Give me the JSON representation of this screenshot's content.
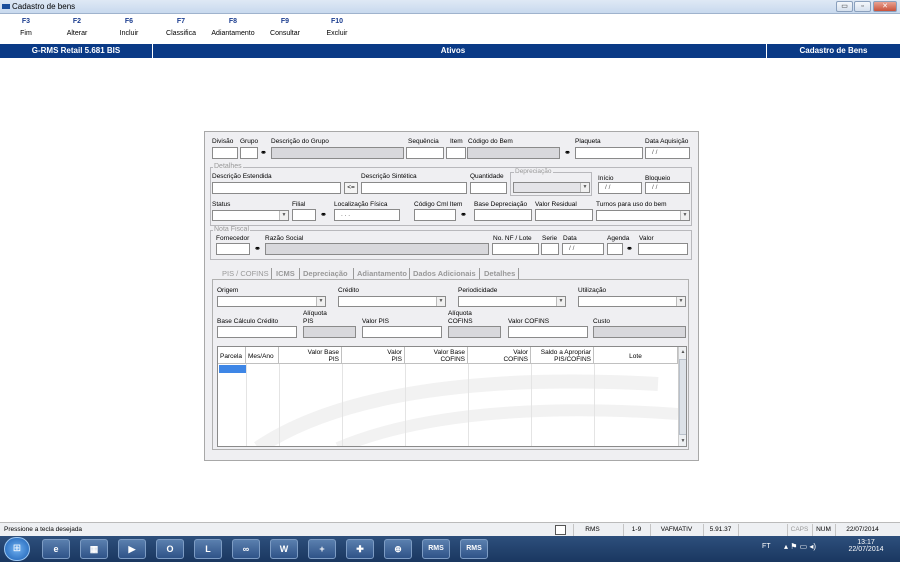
{
  "window": {
    "title": "Cadastro de bens",
    "minimize": "▭",
    "maximize": "▫",
    "close": "✕"
  },
  "toolbar": [
    {
      "key": "F3",
      "label": "Fim"
    },
    {
      "key": "F2",
      "label": "Alterar"
    },
    {
      "key": "F6",
      "label": "Incluir"
    },
    {
      "key": "F7",
      "label": "Classifica"
    },
    {
      "key": "F8",
      "label": "Adiantamento"
    },
    {
      "key": "F9",
      "label": "Consultar"
    },
    {
      "key": "F10",
      "label": "Excluir"
    }
  ],
  "header": {
    "app": "G-RMS Retail 5.681 BIS",
    "status": "Ativos",
    "screen": "Cadastro de Bens"
  },
  "form": {
    "divisao": "Divisão",
    "grupo": "Grupo",
    "desc_grupo": "Descrição do Grupo",
    "sequencia": "Sequência",
    "item": "Item",
    "codigo_bem": "Código do Bem",
    "plaqueta": "Plaqueta",
    "data_aquisicao": "Data Aquisição",
    "data_aquisicao_value": "/ /",
    "detalhes": "Detalhes",
    "desc_estendida": "Descrição Estendida",
    "copy_btn": "<=",
    "desc_sintetica": "Descrição Sintética",
    "quantidade": "Quantidade",
    "depreciacao": "Depreciação",
    "inicio": "Início",
    "inicio_value": "/ /",
    "bloqueio": "Bloqueio",
    "bloqueio_value": "/ /",
    "status": "Status",
    "filial": "Filial",
    "localizacao": "Localização Física",
    "localizacao_value": ". . .",
    "codigo_cml": "Código Cml Item",
    "base_depreciacao": "Base Depreciação",
    "valor_residual": "Valor Residual",
    "turnos": "Turnos para uso do bem",
    "nota_fiscal": "Nota Fiscal",
    "fornecedor": "Fornecedor",
    "razao_social": "Razão Social",
    "nf_lote": "No. NF / Lote",
    "serie": "Serie",
    "data": "Data",
    "data_value": "/ /",
    "agenda": "Agenda",
    "valor": "Valor"
  },
  "tabs": [
    "PIS / COFINS",
    "ICMS",
    "Depreciação",
    "Adiantamento",
    "Dados Adicionais",
    "Detalhes"
  ],
  "pis": {
    "origem": "Origem",
    "credito": "Crédito",
    "periodicidade": "Periodicidade",
    "utilizacao": "Utilização",
    "base_calc": "Base Cálculo Crédito",
    "aliq_pis_1": "Alíquota",
    "aliq_pis_2": "PIS",
    "valor_pis": "Valor PIS",
    "aliq_cofins_1": "Alíquota",
    "aliq_cofins_2": "COFINS",
    "valor_cofins": "Valor COFINS",
    "custo": "Custo"
  },
  "grid": {
    "columns": [
      {
        "l1": "Parcela",
        "l2": ""
      },
      {
        "l1": "Mes/Ano",
        "l2": ""
      },
      {
        "l1": "Valor Base",
        "l2": "PIS"
      },
      {
        "l1": "Valor",
        "l2": "PIS"
      },
      {
        "l1": "Valor Base",
        "l2": "COFINS"
      },
      {
        "l1": "Valor",
        "l2": "COFINS"
      },
      {
        "l1": "Saldo a Apropriar",
        "l2": "PIS/COFINS"
      },
      {
        "l1": "Lote",
        "l2": ""
      }
    ]
  },
  "statusbar": {
    "message": "Pressione a tecla desejada",
    "sys": "RMS",
    "range": "1-9",
    "user": "VAFMATIV",
    "version": "5.91.37",
    "caps": "CAPS",
    "num": "NUM",
    "date": "22/07/2014"
  },
  "taskbar": {
    "lang": "FT",
    "time": "13:17",
    "date": "22/07/2014",
    "apps": [
      "e",
      "▦",
      "▶",
      "O",
      "L",
      "∞",
      "W",
      "+",
      "✚",
      "⊕",
      "RMS",
      "RMS"
    ]
  },
  "colors": {
    "header_blue": "#0a3a86",
    "selection": "#3e86e6"
  }
}
